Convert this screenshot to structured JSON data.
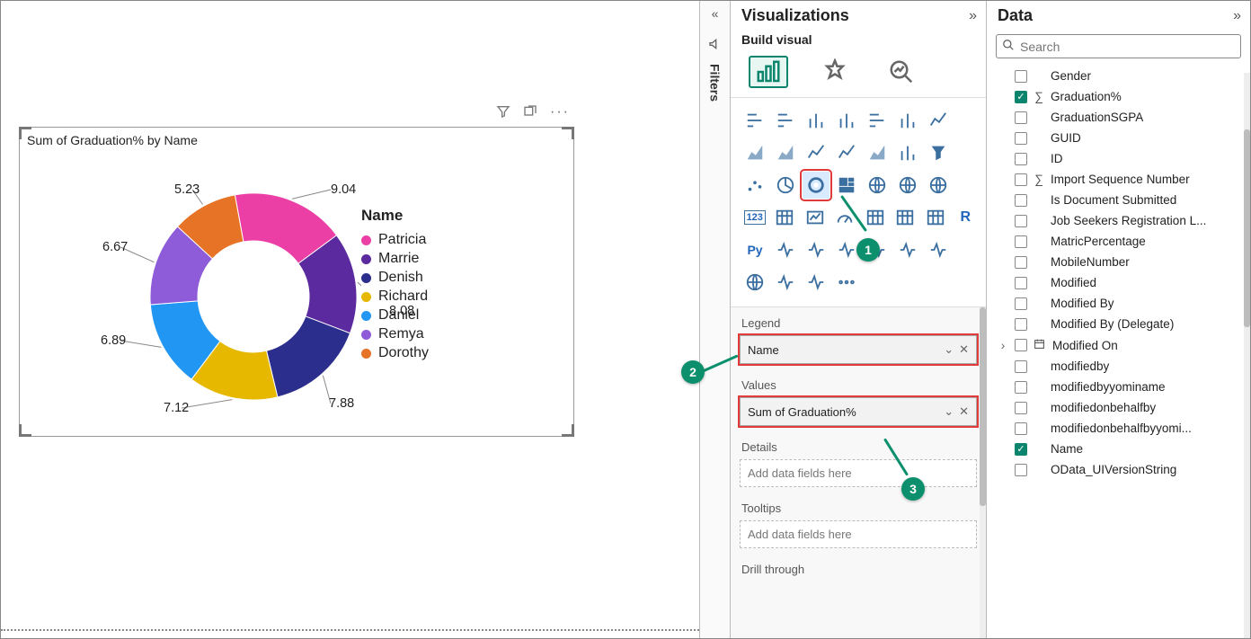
{
  "chart_data": {
    "type": "pie",
    "title": "Sum of Graduation% by Name",
    "legend_title": "Name",
    "series": [
      {
        "name": "Patricia",
        "value": 9.04,
        "color": "#ec3fa5"
      },
      {
        "name": "Marrie",
        "value": 8.08,
        "color": "#5b2a9f"
      },
      {
        "name": "Denish",
        "value": 7.88,
        "color": "#2c2e8e"
      },
      {
        "name": "Richard",
        "value": 7.12,
        "color": "#e6b800"
      },
      {
        "name": "Daniel",
        "value": 6.89,
        "color": "#2196f3"
      },
      {
        "name": "Remya",
        "value": 6.67,
        "color": "#8e5bd9"
      },
      {
        "name": "Dorothy",
        "value": 5.23,
        "color": "#e67326"
      }
    ]
  },
  "toolbar": {
    "filter_icon": "filter",
    "focus_icon": "focus",
    "more_icon": "more"
  },
  "filters": {
    "label": "Filters"
  },
  "viz": {
    "title": "Visualizations",
    "subtitle": "Build visual",
    "wells": {
      "legend_label": "Legend",
      "legend_value": "Name",
      "values_label": "Values",
      "values_value": "Sum of Graduation%",
      "details_label": "Details",
      "details_placeholder": "Add data fields here",
      "tooltips_label": "Tooltips",
      "tooltips_placeholder": "Add data fields here",
      "drill_label": "Drill through"
    },
    "callouts": {
      "c1": "1",
      "c2": "2",
      "c3": "3"
    }
  },
  "data": {
    "title": "Data",
    "search_placeholder": "Search",
    "fields": [
      {
        "name": "Gender",
        "checked": false
      },
      {
        "name": "Graduation%",
        "checked": true,
        "sigma": true
      },
      {
        "name": "GraduationSGPA",
        "checked": false
      },
      {
        "name": "GUID",
        "checked": false
      },
      {
        "name": "ID",
        "checked": false
      },
      {
        "name": "Import Sequence Number",
        "checked": false,
        "sigma": true
      },
      {
        "name": "Is Document Submitted",
        "checked": false
      },
      {
        "name": "Job Seekers Registration L...",
        "checked": false
      },
      {
        "name": "MatricPercentage",
        "checked": false
      },
      {
        "name": "MobileNumber",
        "checked": false
      },
      {
        "name": "Modified",
        "checked": false
      },
      {
        "name": "Modified By",
        "checked": false
      },
      {
        "name": "Modified By (Delegate)",
        "checked": false
      },
      {
        "name": "Modified On",
        "checked": false,
        "expandable": true,
        "date": true
      },
      {
        "name": "modifiedby",
        "checked": false
      },
      {
        "name": "modifiedbyyominame",
        "checked": false
      },
      {
        "name": "modifiedonbehalfby",
        "checked": false
      },
      {
        "name": "modifiedonbehalfbyyomi...",
        "checked": false
      },
      {
        "name": "Name",
        "checked": true
      },
      {
        "name": "OData_UIVersionString",
        "checked": false
      }
    ]
  }
}
